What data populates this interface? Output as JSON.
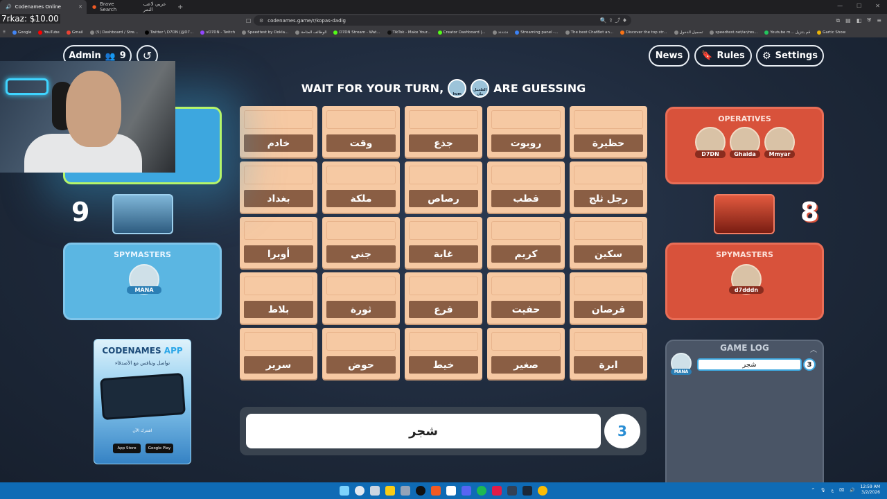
{
  "browser": {
    "tabs": [
      {
        "title": "Codenames Online",
        "active": true
      },
      {
        "title": "Brave Search",
        "extra": "عربي لاعب النمر",
        "active": false
      }
    ],
    "url": "codenames.game/r/kopas-dadig",
    "bookmarks": [
      "Google",
      "YouTube",
      "Gmail",
      "(5) Dashboard / Stre...",
      "Twitter \\ D7DN (@D7...",
      "vD7DN - Twitch",
      "Speedtest by Ookla...",
      "الوظائف المتاحة",
      "D7DN Stream - Wat...",
      "TikTok - Make Your...",
      "Creator Dashboard |...",
      "دددددد",
      "Streaming panel -...",
      "The best ChatBot an...",
      "Discover the top str...",
      "تسجيل الدخول",
      "speedtest.net/ar/res...",
      "Youtube m... قم بتنزيل",
      "Gartic Show"
    ]
  },
  "stream": {
    "donation": "7rkaz: $10.00"
  },
  "header": {
    "admin_label": "Admin",
    "player_count": "9",
    "news_label": "News",
    "rules_label": "Rules",
    "settings_label": "Settings"
  },
  "banner": {
    "text_before": "WAIT FOR YOUR TURN,",
    "text_after": "ARE GUESSING",
    "avatar1": "hum",
    "avatar2": "الطعمل مان"
  },
  "board": {
    "cards": [
      "خادم",
      "وقت",
      "جذع",
      "روبوت",
      "حظيرة",
      "بغداد",
      "ملكة",
      "رصاص",
      "قطب",
      "رجل ثلج",
      "أوبرا",
      "جني",
      "غابة",
      "كريم",
      "سكين",
      "بلاط",
      "ثورة",
      "فرع",
      "حفيت",
      "قرصان",
      "سرير",
      "حوض",
      "خيط",
      "صغير",
      "ابرة"
    ]
  },
  "blue_team": {
    "score": "9",
    "spymasters_title": "SPYMASTERS",
    "spymaster": "MANA",
    "color": "#3da7df"
  },
  "red_team": {
    "score": "8",
    "operatives_title": "OPERATIVES",
    "operatives": [
      "D7DN",
      "Ghaida",
      "Mmyar"
    ],
    "spymasters_title": "SPYMASTERS",
    "spymaster": "d7dddn",
    "color": "#d8523b"
  },
  "app_ad": {
    "title_a": "CODENAMES",
    "title_b": "APP",
    "subtitle": "تواصل وتنافس مع الأصدقاء",
    "cta": "اشترك الآن",
    "app_store": "App Store",
    "google_play": "Google Play"
  },
  "game_log": {
    "title": "GAME LOG",
    "entries": [
      {
        "player": "MANA",
        "clue": "شجر",
        "count": "3"
      }
    ]
  },
  "clue": {
    "word": "شجر",
    "count": "3"
  },
  "taskbar": {
    "time": "12:59 AM",
    "date": "3/2/2026",
    "lang": "ع"
  }
}
